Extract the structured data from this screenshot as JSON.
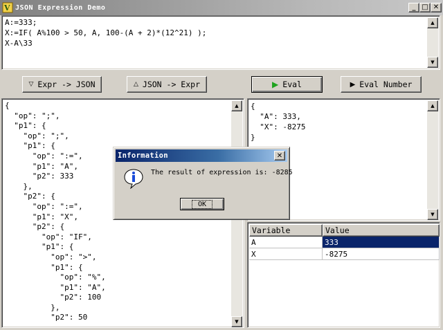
{
  "window": {
    "title": "JSON Expression Demo",
    "controls": [
      "_",
      "□",
      "✕"
    ]
  },
  "editor": {
    "text": "A:=333;\nX:=IF( A%100 > 50, A, 100-(A + 2)*(12^21) );\nX-A\\33"
  },
  "toolbar": {
    "expr_to_json": "Expr -> JSON",
    "json_to_expr": "JSON -> Expr",
    "eval": "Eval",
    "eval_number": "Eval Number"
  },
  "json_output": "{\n  \"op\": \";\",\n  \"p1\": {\n    \"op\": \";\",\n    \"p1\": {\n      \"op\": \":=\",\n      \"p1\": \"A\",\n      \"p2\": 333\n    },\n    \"p2\": {\n      \"op\": \":=\",\n      \"p1\": \"X\",\n      \"p2\": {\n        \"op\": \"IF\",\n        \"p1\": {\n          \"op\": \">\",\n          \"p1\": {\n            \"op\": \"%\",\n            \"p1\": \"A\",\n            \"p2\": 100\n          },\n          \"p2\": 50",
  "result_output": "{\n  \"A\": 333,\n  \"X\": -8275\n}",
  "variables": {
    "headers": [
      "Variable",
      "Value"
    ],
    "rows": [
      {
        "name": "A",
        "value": "333",
        "selected": true
      },
      {
        "name": "X",
        "value": "-8275",
        "selected": false
      }
    ]
  },
  "dialog": {
    "title": "Information",
    "message": "The result of expression is: -8285",
    "ok": "OK"
  },
  "colors": {
    "selection": "#0a246a",
    "eval_icon": "#1fa31f"
  }
}
